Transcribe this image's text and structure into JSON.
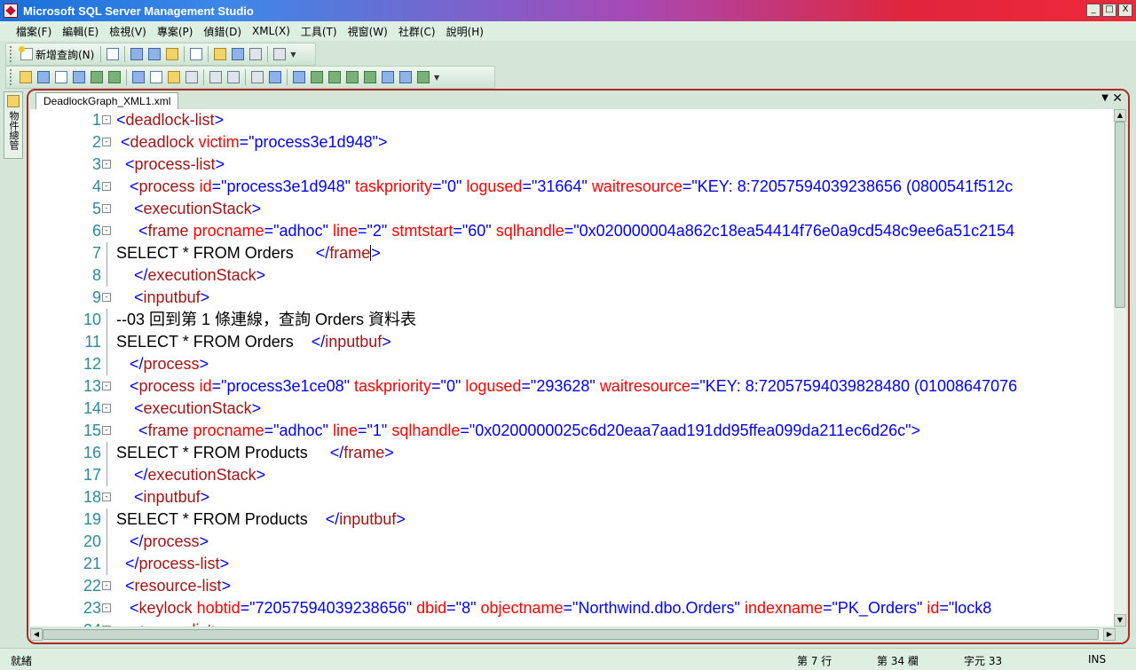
{
  "window": {
    "title": "Microsoft SQL Server Management Studio",
    "minimize": "_",
    "maximize": "□",
    "close": "X"
  },
  "menu": [
    "檔案(F)",
    "編輯(E)",
    "檢視(V)",
    "專案(P)",
    "偵錯(D)",
    "XML(X)",
    "工具(T)",
    "視窗(W)",
    "社群(C)",
    "說明(H)"
  ],
  "toolbar": {
    "new_query_label": "新增查詢(N)"
  },
  "side_panel": {
    "label": "物件總管"
  },
  "document": {
    "tab_label": "DeadlockGraph_XML1.xml",
    "tab_menu_glyph": "▼",
    "tab_close_glyph": "✕"
  },
  "editor_lines": [
    {
      "n": "1",
      "fold": "-",
      "tokens": [
        [
          "b",
          "<"
        ],
        [
          "n",
          "deadlock-list"
        ],
        [
          "b",
          ">"
        ]
      ]
    },
    {
      "n": "2",
      "fold": "-",
      "tokens": [
        [
          "x",
          " "
        ],
        [
          "b",
          "<"
        ],
        [
          "n",
          "deadlock"
        ],
        [
          "x",
          " "
        ],
        [
          "a",
          "victim"
        ],
        [
          "b",
          "=\""
        ],
        [
          "v",
          "process3e1d948"
        ],
        [
          "b",
          "\">"
        ]
      ]
    },
    {
      "n": "3",
      "fold": "-",
      "tokens": [
        [
          "x",
          "  "
        ],
        [
          "b",
          "<"
        ],
        [
          "n",
          "process-list"
        ],
        [
          "b",
          ">"
        ]
      ]
    },
    {
      "n": "4",
      "fold": "-",
      "tokens": [
        [
          "x",
          "   "
        ],
        [
          "b",
          "<"
        ],
        [
          "n",
          "process"
        ],
        [
          "x",
          " "
        ],
        [
          "a",
          "id"
        ],
        [
          "b",
          "=\""
        ],
        [
          "v",
          "process3e1d948"
        ],
        [
          "b",
          "\""
        ],
        [
          "x",
          " "
        ],
        [
          "a",
          "taskpriority"
        ],
        [
          "b",
          "=\""
        ],
        [
          "v",
          "0"
        ],
        [
          "b",
          "\""
        ],
        [
          "x",
          " "
        ],
        [
          "a",
          "logused"
        ],
        [
          "b",
          "=\""
        ],
        [
          "v",
          "31664"
        ],
        [
          "b",
          "\""
        ],
        [
          "x",
          " "
        ],
        [
          "a",
          "waitresource"
        ],
        [
          "b",
          "=\""
        ],
        [
          "v",
          "KEY: 8:72057594039238656 (0800541f512c"
        ]
      ]
    },
    {
      "n": "5",
      "fold": "-",
      "tokens": [
        [
          "x",
          "    "
        ],
        [
          "b",
          "<"
        ],
        [
          "n",
          "executionStack"
        ],
        [
          "b",
          ">"
        ]
      ]
    },
    {
      "n": "6",
      "fold": "-",
      "tokens": [
        [
          "x",
          "     "
        ],
        [
          "b",
          "<"
        ],
        [
          "n",
          "frame"
        ],
        [
          "x",
          " "
        ],
        [
          "a",
          "procname"
        ],
        [
          "b",
          "=\""
        ],
        [
          "v",
          "adhoc"
        ],
        [
          "b",
          "\""
        ],
        [
          "x",
          " "
        ],
        [
          "a",
          "line"
        ],
        [
          "b",
          "=\""
        ],
        [
          "v",
          "2"
        ],
        [
          "b",
          "\""
        ],
        [
          "x",
          " "
        ],
        [
          "a",
          "stmtstart"
        ],
        [
          "b",
          "=\""
        ],
        [
          "v",
          "60"
        ],
        [
          "b",
          "\""
        ],
        [
          "x",
          " "
        ],
        [
          "a",
          "sqlhandle"
        ],
        [
          "b",
          "=\""
        ],
        [
          "v",
          "0x020000004a862c18ea54414f76e0a9cd548c9ee6a51c2154"
        ]
      ]
    },
    {
      "n": "7",
      "fold": "",
      "caret": true,
      "tokens": [
        [
          "x",
          "SELECT * FROM Orders     "
        ],
        [
          "b",
          "</"
        ],
        [
          "n",
          "frame"
        ]
      ],
      "tail": [
        [
          "b",
          ">"
        ]
      ]
    },
    {
      "n": "8",
      "fold": "",
      "tokens": [
        [
          "x",
          "    "
        ],
        [
          "b",
          "</"
        ],
        [
          "n",
          "executionStack"
        ],
        [
          "b",
          ">"
        ]
      ]
    },
    {
      "n": "9",
      "fold": "-",
      "tokens": [
        [
          "x",
          "    "
        ],
        [
          "b",
          "<"
        ],
        [
          "n",
          "inputbuf"
        ],
        [
          "b",
          ">"
        ]
      ]
    },
    {
      "n": "10",
      "fold": "",
      "tokens": [
        [
          "x",
          "--03 回到第 1 條連線，查詢 Orders 資料表"
        ]
      ]
    },
    {
      "n": "11",
      "fold": "",
      "tokens": [
        [
          "x",
          "SELECT * FROM Orders    "
        ],
        [
          "b",
          "</"
        ],
        [
          "n",
          "inputbuf"
        ],
        [
          "b",
          ">"
        ]
      ]
    },
    {
      "n": "12",
      "fold": "",
      "tokens": [
        [
          "x",
          "   "
        ],
        [
          "b",
          "</"
        ],
        [
          "n",
          "process"
        ],
        [
          "b",
          ">"
        ]
      ]
    },
    {
      "n": "13",
      "fold": "-",
      "tokens": [
        [
          "x",
          "   "
        ],
        [
          "b",
          "<"
        ],
        [
          "n",
          "process"
        ],
        [
          "x",
          " "
        ],
        [
          "a",
          "id"
        ],
        [
          "b",
          "=\""
        ],
        [
          "v",
          "process3e1ce08"
        ],
        [
          "b",
          "\""
        ],
        [
          "x",
          " "
        ],
        [
          "a",
          "taskpriority"
        ],
        [
          "b",
          "=\""
        ],
        [
          "v",
          "0"
        ],
        [
          "b",
          "\""
        ],
        [
          "x",
          " "
        ],
        [
          "a",
          "logused"
        ],
        [
          "b",
          "=\""
        ],
        [
          "v",
          "293628"
        ],
        [
          "b",
          "\""
        ],
        [
          "x",
          " "
        ],
        [
          "a",
          "waitresource"
        ],
        [
          "b",
          "=\""
        ],
        [
          "v",
          "KEY: 8:72057594039828480 (01008647076"
        ]
      ]
    },
    {
      "n": "14",
      "fold": "-",
      "tokens": [
        [
          "x",
          "    "
        ],
        [
          "b",
          "<"
        ],
        [
          "n",
          "executionStack"
        ],
        [
          "b",
          ">"
        ]
      ]
    },
    {
      "n": "15",
      "fold": "-",
      "tokens": [
        [
          "x",
          "     "
        ],
        [
          "b",
          "<"
        ],
        [
          "n",
          "frame"
        ],
        [
          "x",
          " "
        ],
        [
          "a",
          "procname"
        ],
        [
          "b",
          "=\""
        ],
        [
          "v",
          "adhoc"
        ],
        [
          "b",
          "\""
        ],
        [
          "x",
          " "
        ],
        [
          "a",
          "line"
        ],
        [
          "b",
          "=\""
        ],
        [
          "v",
          "1"
        ],
        [
          "b",
          "\""
        ],
        [
          "x",
          " "
        ],
        [
          "a",
          "sqlhandle"
        ],
        [
          "b",
          "=\""
        ],
        [
          "v",
          "0x0200000025c6d20eaa7aad191dd95ffea099da211ec6d26c"
        ],
        [
          "b",
          "\">"
        ]
      ]
    },
    {
      "n": "16",
      "fold": "",
      "tokens": [
        [
          "x",
          "SELECT * FROM Products     "
        ],
        [
          "b",
          "</"
        ],
        [
          "n",
          "frame"
        ],
        [
          "b",
          ">"
        ]
      ]
    },
    {
      "n": "17",
      "fold": "",
      "tokens": [
        [
          "x",
          "    "
        ],
        [
          "b",
          "</"
        ],
        [
          "n",
          "executionStack"
        ],
        [
          "b",
          ">"
        ]
      ]
    },
    {
      "n": "18",
      "fold": "-",
      "tokens": [
        [
          "x",
          "    "
        ],
        [
          "b",
          "<"
        ],
        [
          "n",
          "inputbuf"
        ],
        [
          "b",
          ">"
        ]
      ]
    },
    {
      "n": "19",
      "fold": "",
      "tokens": [
        [
          "x",
          "SELECT * FROM Products    "
        ],
        [
          "b",
          "</"
        ],
        [
          "n",
          "inputbuf"
        ],
        [
          "b",
          ">"
        ]
      ]
    },
    {
      "n": "20",
      "fold": "",
      "tokens": [
        [
          "x",
          "   "
        ],
        [
          "b",
          "</"
        ],
        [
          "n",
          "process"
        ],
        [
          "b",
          ">"
        ]
      ]
    },
    {
      "n": "21",
      "fold": "",
      "tokens": [
        [
          "x",
          "  "
        ],
        [
          "b",
          "</"
        ],
        [
          "n",
          "process-list"
        ],
        [
          "b",
          ">"
        ]
      ]
    },
    {
      "n": "22",
      "fold": "-",
      "tokens": [
        [
          "x",
          "  "
        ],
        [
          "b",
          "<"
        ],
        [
          "n",
          "resource-list"
        ],
        [
          "b",
          ">"
        ]
      ]
    },
    {
      "n": "23",
      "fold": "-",
      "tokens": [
        [
          "x",
          "   "
        ],
        [
          "b",
          "<"
        ],
        [
          "n",
          "keylock"
        ],
        [
          "x",
          " "
        ],
        [
          "a",
          "hobtid"
        ],
        [
          "b",
          "=\""
        ],
        [
          "v",
          "72057594039238656"
        ],
        [
          "b",
          "\""
        ],
        [
          "x",
          " "
        ],
        [
          "a",
          "dbid"
        ],
        [
          "b",
          "=\""
        ],
        [
          "v",
          "8"
        ],
        [
          "b",
          "\""
        ],
        [
          "x",
          " "
        ],
        [
          "a",
          "objectname"
        ],
        [
          "b",
          "=\""
        ],
        [
          "v",
          "Northwind.dbo.Orders"
        ],
        [
          "b",
          "\""
        ],
        [
          "x",
          " "
        ],
        [
          "a",
          "indexname"
        ],
        [
          "b",
          "=\""
        ],
        [
          "v",
          "PK_Orders"
        ],
        [
          "b",
          "\""
        ],
        [
          "x",
          " "
        ],
        [
          "a",
          "id"
        ],
        [
          "b",
          "=\""
        ],
        [
          "v",
          "lock8"
        ]
      ]
    },
    {
      "n": "24",
      "fold": "-",
      "tokens": [
        [
          "x",
          "    "
        ],
        [
          "b",
          "<"
        ],
        [
          "n",
          "owner-list"
        ],
        [
          "b",
          ">"
        ]
      ]
    }
  ],
  "status": {
    "ready": "就緒",
    "line": "第 7 行",
    "column": "第 34 欄",
    "char": "字元 33",
    "mode": "INS"
  }
}
